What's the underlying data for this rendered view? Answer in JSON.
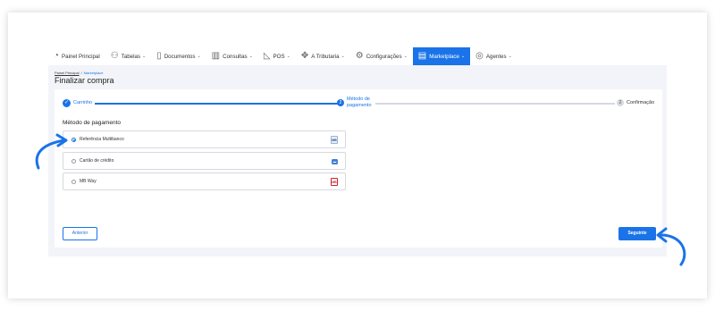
{
  "nav": {
    "items": [
      {
        "label": "Painel Principal",
        "icon": "dashboard-icon",
        "glyph": "◔",
        "chevron": false
      },
      {
        "label": "Tabelas",
        "icon": "users-icon",
        "glyph": "⚇",
        "chevron": true
      },
      {
        "label": "Documentos",
        "icon": "document-icon",
        "glyph": "▯",
        "chevron": true
      },
      {
        "label": "Consultas",
        "icon": "chart-icon",
        "glyph": "▥",
        "chevron": true
      },
      {
        "label": "POS",
        "icon": "pos-icon",
        "glyph": "◺",
        "chevron": true
      },
      {
        "label": "A Tributaria",
        "icon": "tax-icon",
        "glyph": "✥",
        "chevron": true
      },
      {
        "label": "Configurações",
        "icon": "settings-icon",
        "glyph": "⚙",
        "chevron": true
      },
      {
        "label": "Marketplace",
        "icon": "marketplace-icon",
        "glyph": "▤",
        "chevron": true,
        "active": true
      },
      {
        "label": "Agentes",
        "icon": "agents-icon",
        "glyph": "◎",
        "chevron": true
      }
    ],
    "chevron_glyph": "⌄"
  },
  "breadcrumb": {
    "home": "Painel Principal",
    "separator": "/",
    "current": "Marketplace"
  },
  "page": {
    "title": "Finalizar compra"
  },
  "stepper": {
    "step1": {
      "label": "Carrinho",
      "glyph": "✓"
    },
    "step2": {
      "number": "2",
      "label_line1": "Método de",
      "label_line2": "pagamento"
    },
    "step3": {
      "number": "2",
      "label": "Confirmação"
    }
  },
  "payment": {
    "title": "Método de pagamento",
    "options": [
      {
        "label": "Referência Multibanco",
        "selected": true,
        "icon": "multibanco-icon",
        "icon_text": "MB"
      },
      {
        "label": "Cartão de crédito",
        "selected": false,
        "icon": "credit-card-icon",
        "icon_text": "▬"
      },
      {
        "label": "MB Way",
        "selected": false,
        "icon": "mbway-icon",
        "icon_text": "MB"
      }
    ]
  },
  "buttons": {
    "back": "Anterior",
    "next": "Seguinte"
  },
  "colors": {
    "accent": "#1a73e8",
    "background": "#f2f4f9"
  }
}
